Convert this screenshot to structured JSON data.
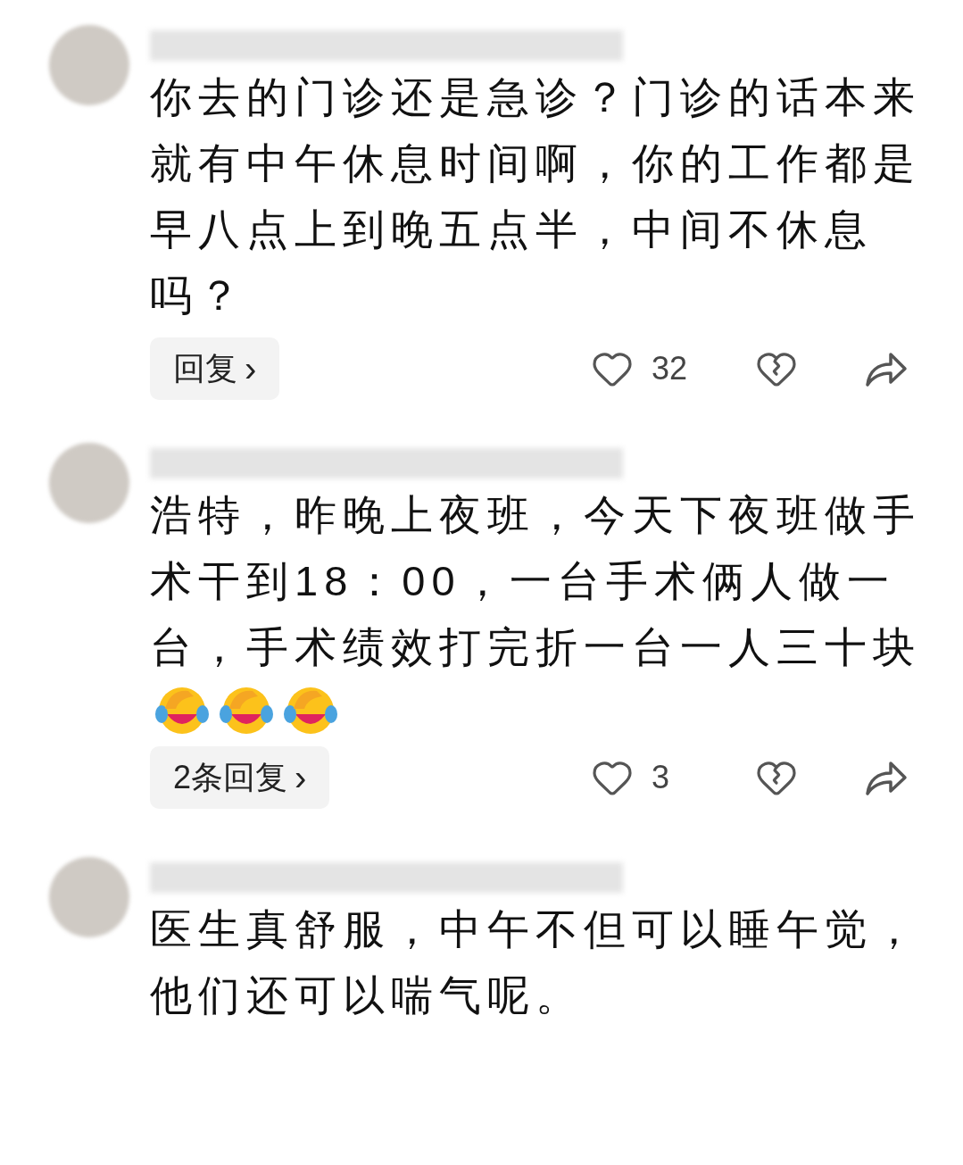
{
  "comments": [
    {
      "text": "你去的门诊还是急诊？门诊的话本来就有中午休息时间啊，你的工作都是早八点上到晚五点半，中间不休息吗？",
      "reply_button": "回复",
      "caret": "›",
      "likes": "32"
    },
    {
      "text": "浩特，昨晚上夜班，今天下夜班做手术干到18：00，一台手术俩人做一台，手术绩效打完折一台一人三十块",
      "emojis": [
        {
          "kind": "facepalm-laugh"
        },
        {
          "kind": "facepalm-laugh"
        },
        {
          "kind": "facepalm-laugh"
        }
      ],
      "reply_button": "2条回复",
      "caret": "›",
      "likes": "3"
    },
    {
      "text": "医生真舒服，中午不但可以睡午觉，他们还可以喘气呢。"
    }
  ]
}
